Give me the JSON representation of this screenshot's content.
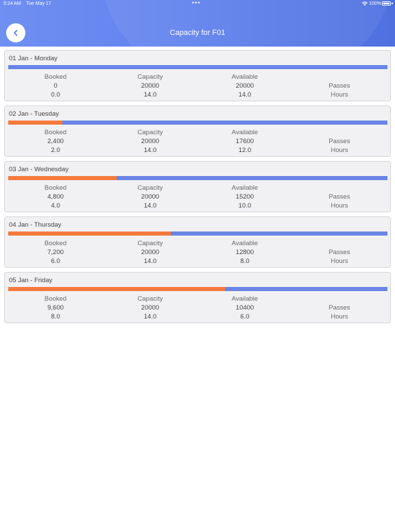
{
  "status_bar": {
    "time": "9:24 AM",
    "date": "Tue May 17",
    "dots": "•••",
    "battery": "100%"
  },
  "header": {
    "title": "Capacity for F01",
    "back_icon": "chevron-left-icon"
  },
  "colors": {
    "booked": "#f47a3c",
    "available": "#6a85e6",
    "header": "#6283ee"
  },
  "columns": {
    "booked": "Booked",
    "capacity": "Capacity",
    "available": "Available",
    "passes": "Passes",
    "hours": "Hours"
  },
  "days": [
    {
      "label": "01 Jan - Monday",
      "booked_passes": "0",
      "capacity_passes": "20000",
      "available_passes": "20000",
      "booked_hours": "0.0",
      "capacity_hours": "14.0",
      "available_hours": "14.0",
      "booked_fraction": 0.0
    },
    {
      "label": "02 Jan - Tuesday",
      "booked_passes": "2,400",
      "capacity_passes": "20000",
      "available_passes": "17600",
      "booked_hours": "2.0",
      "capacity_hours": "14.0",
      "available_hours": "12.0",
      "booked_fraction": 0.143
    },
    {
      "label": "03 Jan - Wednesday",
      "booked_passes": "4,800",
      "capacity_passes": "20000",
      "available_passes": "15200",
      "booked_hours": "4.0",
      "capacity_hours": "14.0",
      "available_hours": "10.0",
      "booked_fraction": 0.286
    },
    {
      "label": "04 Jan - Thursday",
      "booked_passes": "7,200",
      "capacity_passes": "20000",
      "available_passes": "12800",
      "booked_hours": "6.0",
      "capacity_hours": "14.0",
      "available_hours": "8.0",
      "booked_fraction": 0.429
    },
    {
      "label": "05 Jan - Friday",
      "booked_passes": "9,600",
      "capacity_passes": "20000",
      "available_passes": "10400",
      "booked_hours": "8.0",
      "capacity_hours": "14.0",
      "available_hours": "6.0",
      "booked_fraction": 0.571
    }
  ]
}
